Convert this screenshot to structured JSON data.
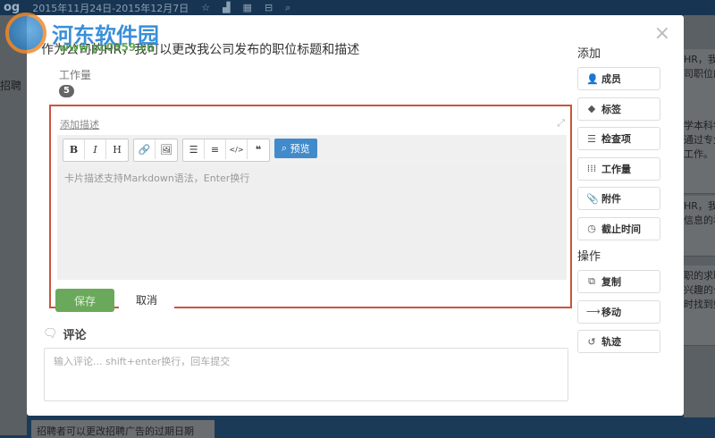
{
  "topbar": {
    "brand": "og",
    "date_range": "2015年11月24日-2015年12月7日"
  },
  "background": {
    "left_text": "招聘",
    "right_cards": [
      "HR，我\n司职位的",
      "学本科学\n通过专业\n工作。",
      "HR，我\n信息的看",
      "职的求职\n兴趣的公\n时找到好"
    ],
    "bottom_card": "招聘者可以更改招聘广告的过期日期"
  },
  "watermark": {
    "name": "河东软件园",
    "url": "www.pc0359.cn"
  },
  "modal": {
    "title": "作为公司的HR，我可以更改我公司发布的职位标题和描述",
    "workload_label": "工作量",
    "workload_value": "5",
    "editor": {
      "add_desc": "添加描述",
      "toolbar": [
        "B",
        "I",
        "H",
        "🔗",
        "🖼",
        "☰",
        "≡",
        "</>",
        "❝"
      ],
      "preview": "预览",
      "placeholder": "卡片描述支持Markdown语法，Enter换行",
      "save": "保存",
      "cancel": "取消"
    },
    "comments": {
      "heading": "评论",
      "placeholder": "输入评论... shift+enter换行，回车提交"
    },
    "sidebar": {
      "add_heading": "添加",
      "add_items": [
        {
          "icon": "user-plus",
          "label": "成员"
        },
        {
          "icon": "tag",
          "label": "标签"
        },
        {
          "icon": "list",
          "label": "检查项"
        },
        {
          "icon": "grid",
          "label": "工作量"
        },
        {
          "icon": "paperclip",
          "label": "附件"
        },
        {
          "icon": "clock",
          "label": "截止时间"
        }
      ],
      "ops_heading": "操作",
      "op_items": [
        {
          "icon": "copy",
          "label": "复制"
        },
        {
          "icon": "arrow-right",
          "label": "移动"
        },
        {
          "icon": "history",
          "label": "轨迹"
        }
      ]
    }
  }
}
